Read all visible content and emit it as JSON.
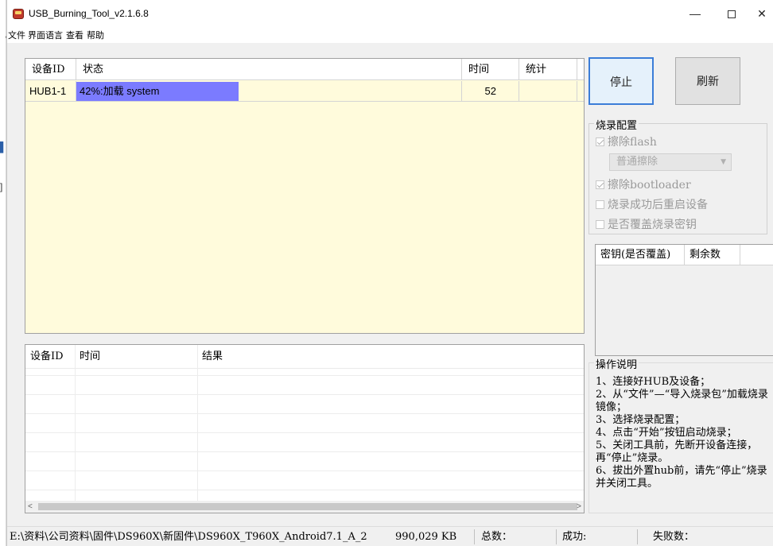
{
  "window": {
    "title": "USB_Burning_Tool_v2.1.6.8",
    "minimize": "—",
    "maximize": "",
    "close": "✕"
  },
  "menu": [
    "文件",
    "界面语言",
    "查看",
    "帮助"
  ],
  "main_table": {
    "headers": [
      "设备ID",
      "状态",
      "时间",
      "统计"
    ],
    "rows": [
      {
        "device_id": "HUB1-1",
        "status": "42%:加载 system",
        "progress": 0.42,
        "time": "52",
        "stats": ""
      }
    ]
  },
  "buttons": {
    "stop": "停止",
    "refresh": "刷新"
  },
  "burn_config": {
    "title": "烧录配置",
    "erase_flash": "擦除flash",
    "erase_mode": "普通擦除",
    "erase_bootloader": "擦除bootloader",
    "reboot_after_success": "烧录成功后重启设备",
    "overwrite_key": "是否覆盖烧录密钥"
  },
  "key_table": {
    "headers": [
      "密钥(是否覆盖)",
      "剩余数"
    ]
  },
  "instructions": {
    "title": "操作说明",
    "lines": [
      "1、连接好HUB及设备；",
      "2、从“文件”—“导入烧录包”加载烧录镜像；",
      "3、选择烧录配置；",
      "4、点击“开始”按钮启动烧录；",
      "5、关闭工具前，先断开设备连接，再“停止”烧录。",
      "6、拔出外置hub前，请先“停止”烧录并关闭工具。"
    ]
  },
  "log_table": {
    "headers": [
      "设备ID",
      "时间",
      "结果"
    ]
  },
  "status_bar": {
    "path": "E:\\资料\\公司资料\\固件\\DS960X\\新固件\\DS960X_T960X_Android7.1_A_2",
    "size": "990,029 KB",
    "total": "总数：",
    "success": "成功:",
    "fail": "失败数："
  },
  "colors": {
    "progress": "#7b7bff",
    "table_bg": "#fffbdc",
    "stop_border": "#3b7dd8"
  }
}
